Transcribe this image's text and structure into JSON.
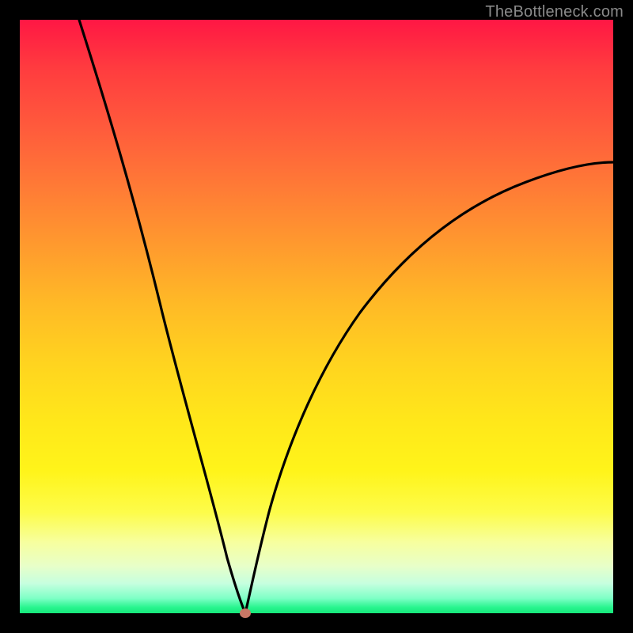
{
  "watermark": "TheBottleneck.com",
  "colors": {
    "frame": "#000000",
    "curve": "#000000",
    "marker": "#c87866"
  },
  "chart_data": {
    "type": "line",
    "title": "",
    "xlabel": "",
    "ylabel": "",
    "xlim": [
      0,
      100
    ],
    "ylim": [
      0,
      100
    ],
    "grid": false,
    "legend": false,
    "notes": "V-shaped bottleneck curve on vertical red→green gradient. Minimum (optimal point) marked by dot.",
    "series": [
      {
        "name": "left-branch",
        "x": [
          10,
          12,
          14,
          16,
          18,
          20,
          22,
          24,
          26,
          28,
          30,
          32,
          34,
          36,
          38
        ],
        "y": [
          100,
          90,
          80,
          70,
          60,
          50,
          41,
          33,
          25,
          18,
          12,
          7.5,
          3.8,
          1.3,
          0
        ]
      },
      {
        "name": "right-branch",
        "x": [
          38,
          40,
          44,
          48,
          52,
          56,
          60,
          64,
          68,
          72,
          76,
          80,
          84,
          88,
          92,
          96,
          100
        ],
        "y": [
          0,
          3,
          11,
          19,
          27,
          34,
          40,
          46,
          51,
          56,
          60,
          64,
          67,
          70,
          72,
          74,
          76
        ]
      }
    ],
    "marker": {
      "x": 38,
      "y": 0
    }
  }
}
